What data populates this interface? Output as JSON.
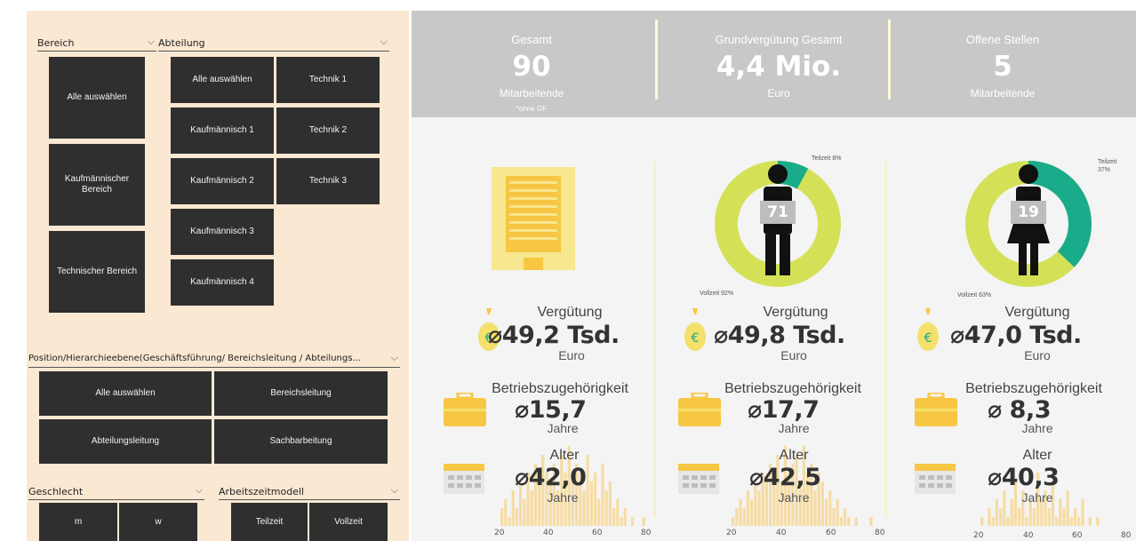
{
  "filters": {
    "bereich": {
      "label": "Bereich",
      "items": [
        "Alle auswählen",
        "Kaufmännischer Bereich",
        "Technischer Bereich"
      ]
    },
    "abteilung": {
      "label": "Abteilung",
      "items": [
        "Alle auswählen",
        "Technik 1",
        "Kaufmännisch 1",
        "Technik 2",
        "Kaufmännisch 2",
        "Technik 3",
        "Kaufmännisch 3",
        "Kaufmännisch 4"
      ]
    },
    "position": {
      "label": "Position/Hierarchieebene(Geschäftsführung/ Bereichsleitung / Abteilungs...",
      "items": [
        "Alle auswählen",
        "Bereichsleitung",
        "Abteilungsleitung",
        "Sachbarbeitung"
      ]
    },
    "geschlecht": {
      "label": "Geschlecht",
      "items": [
        "m",
        "w"
      ]
    },
    "arbeitszeit": {
      "label": "Arbeitszeitmodell",
      "items": [
        "Teilzeit",
        "Vollzeit"
      ]
    }
  },
  "kpis": [
    {
      "label": "Gesamt",
      "value": "90",
      "unit": "Mitarbeitende",
      "note": "*ohne GF"
    },
    {
      "label": "Grundvergütung Gesamt",
      "value": "4,4 Mio.",
      "unit": "Euro"
    },
    {
      "label": "Offene Stellen",
      "value": "5",
      "unit": "Mitarbeitende"
    }
  ],
  "columns": [
    {
      "icon": "building-icon",
      "verguetung_label": "Vergütung",
      "verguetung_value": "⌀49,2 Tsd.",
      "verguetung_unit": "Euro",
      "betrieb_label": "Betriebszugehörigkeit",
      "betrieb_value": "⌀15,7",
      "betrieb_unit": "Jahre",
      "alter_label": "Alter",
      "alter_value": "⌀42,0",
      "alter_unit": "Jahre"
    },
    {
      "icon": "man-icon",
      "count": "71",
      "teilzeit_label": "Teilzeit 8%",
      "vollzeit_label": "Vollzeit 92%",
      "teilzeit_fraction": 0.08,
      "verguetung_label": "Vergütung",
      "verguetung_value": "⌀49,8 Tsd.",
      "verguetung_unit": "Euro",
      "betrieb_label": "Betriebszugehörigkeit",
      "betrieb_value": "⌀17,7",
      "betrieb_unit": "Jahre",
      "alter_label": "Alter",
      "alter_value": "⌀42,5",
      "alter_unit": "Jahre"
    },
    {
      "icon": "woman-icon",
      "count": "19",
      "teilzeit_label": "Teilzeit\n37%",
      "vollzeit_label": "Vollzeit 63%",
      "teilzeit_fraction": 0.37,
      "verguetung_label": "Vergütung",
      "verguetung_value": "⌀47,0 Tsd.",
      "verguetung_unit": "Euro",
      "betrieb_label": "Betriebszugehörigkeit",
      "betrieb_value": "⌀ 8,3",
      "betrieb_unit": "Jahre",
      "alter_label": "Alter",
      "alter_value": "⌀40,3",
      "alter_unit": "Jahre"
    }
  ],
  "age_axis_ticks": [
    "20",
    "40",
    "60",
    "80"
  ],
  "colors": {
    "accent_yellow": "#f7c744",
    "donut_light": "#d4e157",
    "donut_teal": "#1aab8a",
    "tile": "#2f2f2f",
    "panel": "#fbe8d2",
    "band": "#c8c8c8"
  }
}
